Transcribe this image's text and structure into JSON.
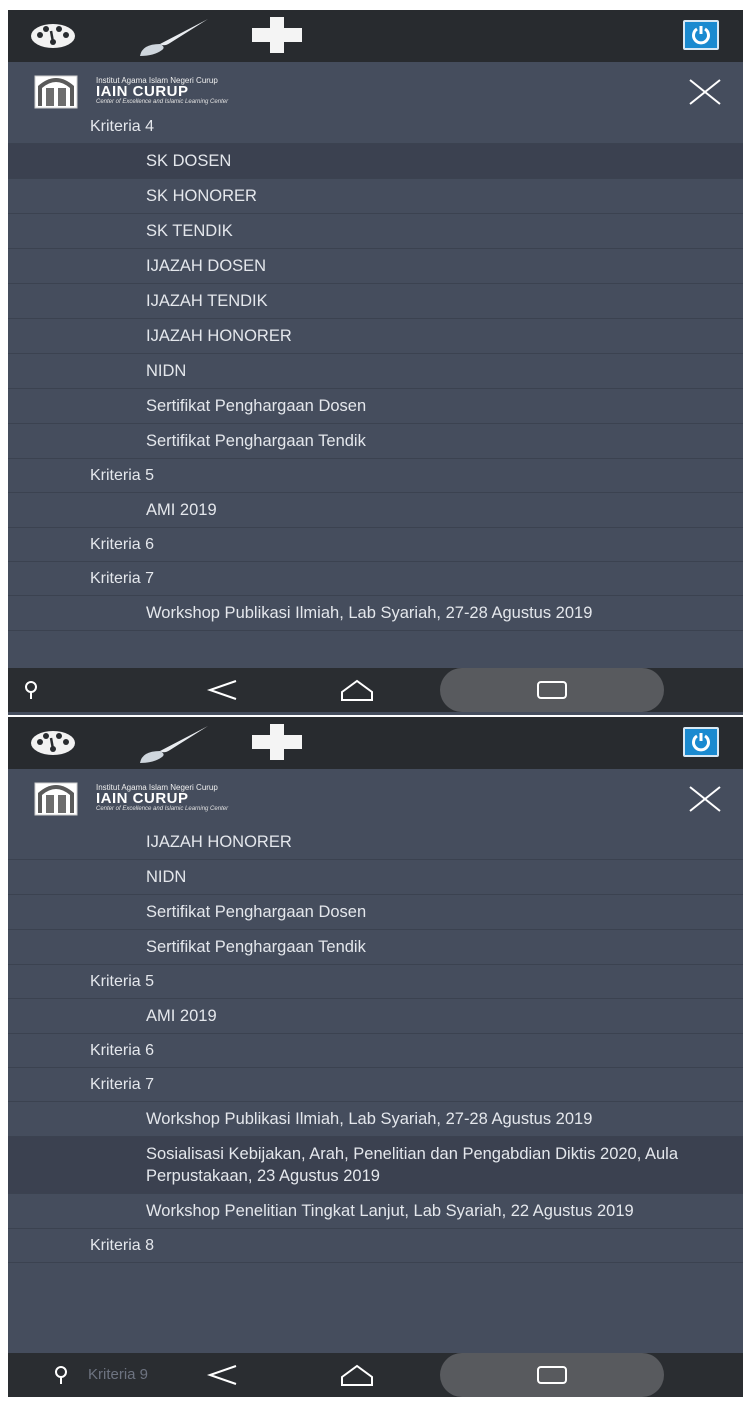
{
  "brand": {
    "institution": "Institut Agama Islam Negeri Curup",
    "name": "IAIN CURUP",
    "tagline": "Center of Excellence and Islamic Learning Center"
  },
  "icons": {
    "top": [
      "gauge-icon",
      "paint-brush-icon",
      "plus-icon",
      "power-icon"
    ],
    "header": [
      "logo-emblem",
      "close-icon"
    ],
    "nav": [
      "search-icon",
      "back-icon",
      "home-icon",
      "recents-icon"
    ]
  },
  "screen1": {
    "menu": [
      {
        "label": "Kriteria 4",
        "level": 1,
        "active": false
      },
      {
        "label": "SK DOSEN",
        "level": 2,
        "active": true
      },
      {
        "label": "SK HONORER",
        "level": 2,
        "active": false
      },
      {
        "label": "SK TENDIK",
        "level": 2,
        "active": false
      },
      {
        "label": "IJAZAH DOSEN",
        "level": 2,
        "active": false
      },
      {
        "label": "IJAZAH TENDIK",
        "level": 2,
        "active": false
      },
      {
        "label": "IJAZAH HONORER",
        "level": 2,
        "active": false
      },
      {
        "label": "NIDN",
        "level": 2,
        "active": false
      },
      {
        "label": "Sertifikat Penghargaan Dosen",
        "level": 2,
        "active": false
      },
      {
        "label": "Sertifikat Penghargaan Tendik",
        "level": 2,
        "active": false
      },
      {
        "label": "Kriteria 5",
        "level": 1,
        "active": false
      },
      {
        "label": "AMI 2019",
        "level": 2,
        "active": false
      },
      {
        "label": "Kriteria 6",
        "level": 1,
        "active": false
      },
      {
        "label": "Kriteria 7",
        "level": 1,
        "active": false
      },
      {
        "label": "Workshop Publikasi Ilmiah, Lab Syariah, 27-28 Agustus 2019",
        "level": 2,
        "active": false
      }
    ]
  },
  "screen2": {
    "menu": [
      {
        "label": "IJAZAH HONORER",
        "level": 2,
        "active": false
      },
      {
        "label": "NIDN",
        "level": 2,
        "active": false
      },
      {
        "label": "Sertifikat Penghargaan Dosen",
        "level": 2,
        "active": false
      },
      {
        "label": "Sertifikat Penghargaan Tendik",
        "level": 2,
        "active": false
      },
      {
        "label": "Kriteria 5",
        "level": 1,
        "active": false
      },
      {
        "label": "AMI 2019",
        "level": 2,
        "active": false
      },
      {
        "label": "Kriteria 6",
        "level": 1,
        "active": false
      },
      {
        "label": "Kriteria 7",
        "level": 1,
        "active": false
      },
      {
        "label": "Workshop Publikasi Ilmiah, Lab Syariah, 27-28 Agustus 2019",
        "level": 2,
        "active": false
      },
      {
        "label": "Sosialisasi Kebijakan, Arah, Penelitian dan Pengabdian Diktis 2020, Aula Perpustakaan, 23 Agustus 2019",
        "level": 2,
        "active": true
      },
      {
        "label": "Workshop Penelitian Tingkat Lanjut, Lab Syariah, 22 Agustus 2019",
        "level": 2,
        "active": false
      },
      {
        "label": "Kriteria 8",
        "level": 1,
        "active": false
      }
    ],
    "peek_item": "Kriteria 9"
  },
  "colors": {
    "topbar": "#282b2f",
    "menu_bg": "#454d5d",
    "menu_active": "#3b4150",
    "power_button": "#1a8ad0",
    "navbar": "#2a2d31"
  }
}
